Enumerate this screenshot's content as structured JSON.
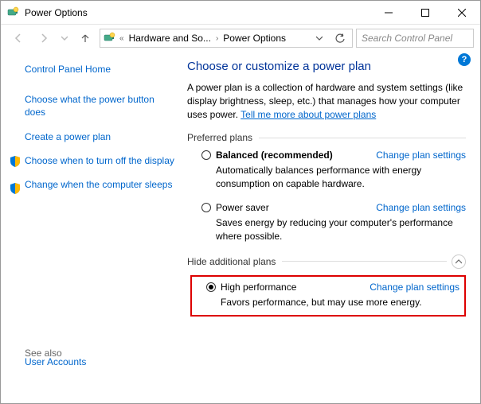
{
  "window": {
    "title": "Power Options"
  },
  "breadcrumb": {
    "item1": "Hardware and So...",
    "item2": "Power Options"
  },
  "search": {
    "placeholder": "Search Control Panel"
  },
  "sidebar": {
    "home": "Control Panel Home",
    "links": [
      "Choose what the power button does",
      "Create a power plan",
      "Choose when to turn off the display",
      "Change when the computer sleeps"
    ],
    "see_also": "See also",
    "user_accounts": "User Accounts"
  },
  "main": {
    "heading": "Choose or customize a power plan",
    "desc_pre": "A power plan is a collection of hardware and system settings (like display brightness, sleep, etc.) that manages how your computer uses power. ",
    "desc_link": "Tell me more about power plans",
    "preferred_label": "Preferred plans",
    "hide_label": "Hide additional plans",
    "change_settings": "Change plan settings",
    "plans": {
      "balanced": {
        "name": "Balanced (recommended)",
        "desc": "Automatically balances performance with energy consumption on capable hardware."
      },
      "saver": {
        "name": "Power saver",
        "desc": "Saves energy by reducing your computer's performance where possible."
      },
      "high": {
        "name": "High performance",
        "desc": "Favors performance, but may use more energy."
      }
    }
  }
}
